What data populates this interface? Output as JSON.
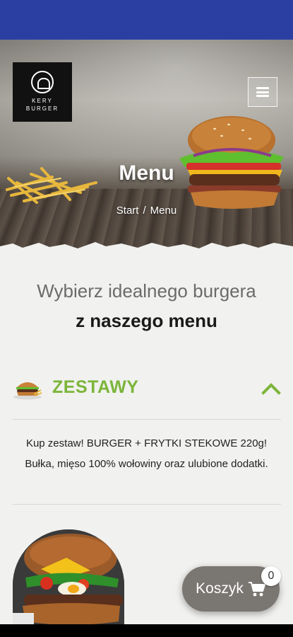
{
  "hero": {
    "logo_line1": "KERY",
    "logo_line2": "BURGER",
    "title": "Menu",
    "breadcrumb": {
      "home": "Start",
      "separator": "/",
      "current": "Menu"
    }
  },
  "intro": {
    "line1": "Wybierz idealnego burgera",
    "line2": "z naszego menu"
  },
  "category": {
    "label": "ZESTAWY",
    "icon": "burger-icon",
    "description": "Kup zestaw! BURGER + FRYTKI STEKOWE 220g! Bułka, mięso 100% wołowiny oraz ulubione dodatki.",
    "expanded": true
  },
  "cart": {
    "label": "Koszyk",
    "count": "0"
  },
  "colors": {
    "status_bar": "#2b3fa3",
    "accent_green": "#7cb53a",
    "cart_button": "#7a7672"
  }
}
